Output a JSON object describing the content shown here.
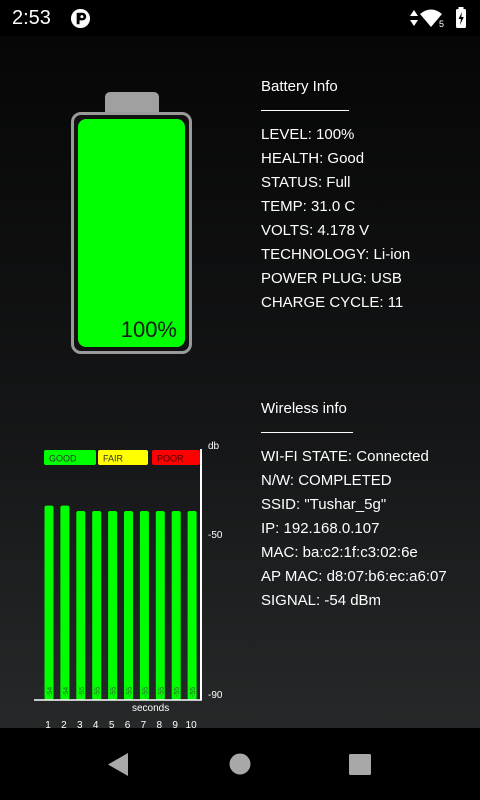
{
  "status_bar": {
    "time": "2:53",
    "network_badge": "5",
    "icons": [
      "app-notification-icon",
      "vibrate-icon",
      "wifi-icon",
      "signal-5g-icon",
      "battery-charging-icon"
    ]
  },
  "battery": {
    "percent_label": "100%",
    "level_fraction": 1.0,
    "fill_color": "#00ff00",
    "info": {
      "title": "Battery Info",
      "rows": [
        "LEVEL: 100%",
        "HEALTH: Good",
        "STATUS: Full",
        "TEMP: 31.0 C",
        "VOLTS: 4.178 V",
        "TECHNOLOGY: Li-ion",
        "POWER PLUG: USB",
        "CHARGE CYCLE: 11"
      ]
    }
  },
  "wireless": {
    "info": {
      "title": "Wireless info",
      "rows": [
        "WI-FI STATE: Connected",
        "N/W: COMPLETED",
        "SSID: \"Tushar_5g\"",
        "IP: 192.168.0.107",
        "MAC: ba:c2:1f:c3:02:6e",
        "AP MAC: d8:07:b6:ec:a6:07",
        "SIGNAL: -54 dBm"
      ]
    }
  },
  "chart_data": {
    "type": "bar",
    "categories": [
      "1",
      "2",
      "3",
      "4",
      "5",
      "6",
      "7",
      "8",
      "9",
      "10"
    ],
    "values": [
      -54,
      -54,
      -55,
      -55,
      -55,
      -55,
      -55,
      -55,
      -55,
      -55
    ],
    "bar_labels": [
      "-54",
      "-54",
      "-55",
      "-55",
      "-55",
      "-55",
      "-55",
      "-55",
      "-55",
      "-55"
    ],
    "xlabel": "seconds",
    "ylabel": "db",
    "yticks": [
      "-50",
      "-90"
    ],
    "ylim": [
      -90,
      -40
    ],
    "grid": false,
    "bar_color": "#00ff00",
    "legend": [
      {
        "label": "GOOD",
        "color": "#00ff00"
      },
      {
        "label": "FAIR",
        "color": "#ffff00"
      },
      {
        "label": "POOR",
        "color": "#ff0000"
      }
    ]
  },
  "nav_bar": {
    "buttons": [
      "back-icon",
      "home-icon",
      "recents-icon"
    ]
  }
}
